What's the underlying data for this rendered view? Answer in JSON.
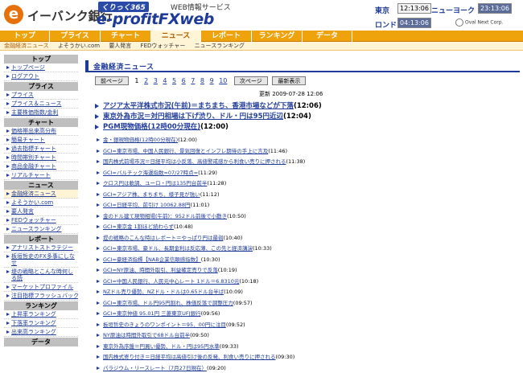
{
  "header": {
    "logo_letter": "e",
    "bank_name": "イーバンク銀行",
    "badge": "くりっく365",
    "brand": "e-profitFXweb",
    "web_info": "WEB情報サービス",
    "cities": [
      {
        "name": "東京",
        "time": "12:13:06"
      },
      {
        "name": "ニューヨーク",
        "time": "23:13:06"
      },
      {
        "name": "ロンドン",
        "time": "04:13:06"
      }
    ],
    "oval_logo": "Oval Next Corp."
  },
  "nav": {
    "tabs": [
      "トップ",
      "プライス",
      "チャート",
      "ニュース",
      "レポート",
      "ランキング",
      "データ"
    ],
    "active": "ニュース"
  },
  "subnav": {
    "items": [
      "金融経済ニュース",
      "よそうかい.com",
      "要人発言",
      "FEDウォッチャー",
      "ニュースランキング"
    ]
  },
  "sidebar": {
    "sections": [
      {
        "title": "トップ",
        "items": [
          "トップページ",
          "ログアウト"
        ]
      },
      {
        "title": "プライス",
        "items": [
          "プライス",
          "プライス＆ニュース",
          "主要株価指数/金利"
        ]
      },
      {
        "title": "チャート",
        "items": [
          "価格帯出来高分布",
          "簡易チャート",
          "過去指標チャート",
          "時間帯別チャート",
          "商品金融チャート",
          "リアルチャート"
        ]
      },
      {
        "title": "ニュース",
        "items": [
          "金融経済ニュース",
          "よそうかい.com",
          "要人発言",
          "FEDウォッチャー",
          "ニュースランキング"
        ]
      },
      {
        "title": "レポート",
        "items": [
          "アナリストストラテジー",
          "板垣哲史のFX多事にしなせ",
          "堤の戦略とこんな時何しる読",
          "マーケットプロファイル",
          "注目指標フラッシュバック"
        ]
      },
      {
        "title": "ランキング",
        "items": [
          "上昇率ランキング",
          "下落率ランキング",
          "出来高ランキング"
        ]
      },
      {
        "title": "データ",
        "items": []
      }
    ]
  },
  "main": {
    "title": "金融経済ニュース",
    "pager": {
      "prev": "前ページ",
      "pages": [
        "1",
        "2",
        "3",
        "4",
        "5",
        "6",
        "7",
        "8",
        "9",
        "10"
      ],
      "current": "1",
      "next": "次ページ",
      "latest": "最新表示"
    },
    "updated": "更新 2009-07-28 12:06",
    "headlines": [
      {
        "text": "アジア太平洋株式市況(午前)＝まちまち、香港市場などが下落",
        "time": "(12:06)"
      },
      {
        "text": "東京外為市況＝対円相場は下げ渋り、ドル・円は95円近辺",
        "time": "(12:04)"
      },
      {
        "text": "PGM現物価格(12時00分現在)",
        "time": "(12:00)"
      }
    ],
    "news": [
      {
        "text": "金・銀現物価格(12時00分現在)",
        "time": "(12:00)"
      },
      {
        "text": "GCI=東京市場、中国人民銀行、景気回復とインフレ期待の手上に言及",
        "time": "(11:46)"
      },
      {
        "text": "国内株式前場市況＝日経平均は小反落、高値警戒感から利食い売りに押される",
        "time": "(11:38)"
      },
      {
        "text": "GCI=バルチック海運指数=07/27時点=",
        "time": "(11:29)"
      },
      {
        "text": "クロス円は軟調、ユーロ・円は135円台前半",
        "time": "(11:28)"
      },
      {
        "text": "GCI=アジア株、まちまち、様子見が強い",
        "time": "(11:12)"
      },
      {
        "text": "GCI=日経平均、前引け 10062.88円",
        "time": "(11:01)"
      },
      {
        "text": "金のドル建て現物相場(午前)：952ドル前後で小動き",
        "time": "(10:50)"
      },
      {
        "text": "GCI=東京金 1割ほど続わらず",
        "time": "(10:48)"
      },
      {
        "text": "堤の戦略のこんな時はレポート＝やっぱり円は最弱",
        "time": "(10:40)"
      },
      {
        "text": "GCI=東京市場、豪ドル、長期金利は反応薄、この先と経済講演",
        "time": "(10:33)"
      },
      {
        "text": "GCI=豪経済指標【NAB企業信頼感指数】",
        "time": "(10:30)"
      },
      {
        "text": "GCI=NY原油、時間外取引、利益確定売りで反落",
        "time": "(10:19)"
      },
      {
        "text": "GCI=中国人民銀行、人民元中心レート 1ドル＝6.8310元",
        "time": "(10:18)"
      },
      {
        "text": "NZドル売り優勢、NZドル・ドルは0.65ドル台半ば",
        "time": "(10:09)"
      },
      {
        "text": "GCI=東京市場、ドル円95円割れ、株価反落で調整圧力",
        "time": "(09:57)"
      },
      {
        "text": "GCI=東京仲値 95.01円 三菱東京UFJ銀行",
        "time": "(09:56)"
      },
      {
        "text": "板垣哲史のきょうのワンポイント＝95．00円に注目",
        "time": "(09:52)"
      },
      {
        "text": "NY原油は時間外取引で68ドル台前半",
        "time": "(09:50)"
      },
      {
        "text": "東京外為序盤＝円買い優勢、ドル・円は95円水準",
        "time": "(09:33)"
      },
      {
        "text": "国内株式寄り付き＝日経平均は高値引け後の反発、利食い売りに押される",
        "time": "(09:30)"
      },
      {
        "text": "パラジウム・リースレート（7月27日現在）",
        "time": "(09:20)"
      }
    ]
  }
}
